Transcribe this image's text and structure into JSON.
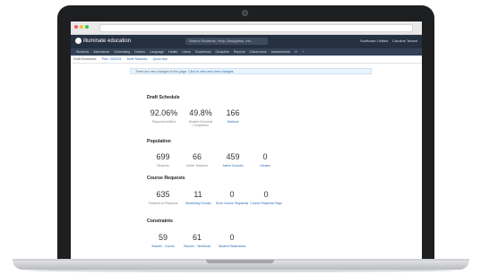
{
  "browser": {
    "url_text": ""
  },
  "app": {
    "logo": "illuminate education",
    "search_placeholder": "Search Students, Help, Navigation, etc...",
    "user_label": "Sunflower Unified",
    "account_label": "Caroline Tenant"
  },
  "nav": [
    "Students",
    "Attendance",
    "Scheduling",
    "Grades",
    "Language",
    "Health",
    "Users",
    "Gradebook",
    "Discipline",
    "Reports",
    "Classrooms",
    "Assessments"
  ],
  "subtabs": {
    "draft": "Draft Schedules",
    "year": "Prev. 2020/21",
    "status": "Draft Statuses",
    "quick": "Quick Nav"
  },
  "banner": {
    "text": "There are new changes in this page.",
    "link": "Click to view and clear changes"
  },
  "sections": {
    "draft_schedule": {
      "title": "Draft Schedule",
      "stats": [
        {
          "value": "92.06%",
          "label": "Requests fulfilled",
          "link": false
        },
        {
          "value": "49.8%",
          "label": "Student Schedule Completion",
          "link": false
        },
        {
          "value": "166",
          "label": "Sections",
          "link": true
        }
      ]
    },
    "population": {
      "title": "Population",
      "stats": [
        {
          "value": "699",
          "label": "Students",
          "link": false
        },
        {
          "value": "66",
          "label": "Active Teachers",
          "link": false
        },
        {
          "value": "459",
          "label": "Active Courses",
          "link": true
        },
        {
          "value": "0",
          "label": "Houses",
          "link": true
        }
      ]
    },
    "course_requests": {
      "title": "Course Requests",
      "stats": [
        {
          "value": "635",
          "label": "Students w/ Requests",
          "link": false
        },
        {
          "value": "11",
          "label": "Scheduling Groups",
          "link": true
        },
        {
          "value": "0",
          "label": "Short Course Segments",
          "link": true
        },
        {
          "value": "0",
          "label": "Course Requests Flags",
          "link": true
        }
      ]
    },
    "constraints": {
      "title": "Constraints",
      "stats": [
        {
          "value": "59",
          "label": "Teacher - Course",
          "link": true
        },
        {
          "value": "61",
          "label": "Teacher - Timeblock",
          "link": true
        },
        {
          "value": "0",
          "label": "Student Restrictions",
          "link": true
        }
      ]
    }
  }
}
